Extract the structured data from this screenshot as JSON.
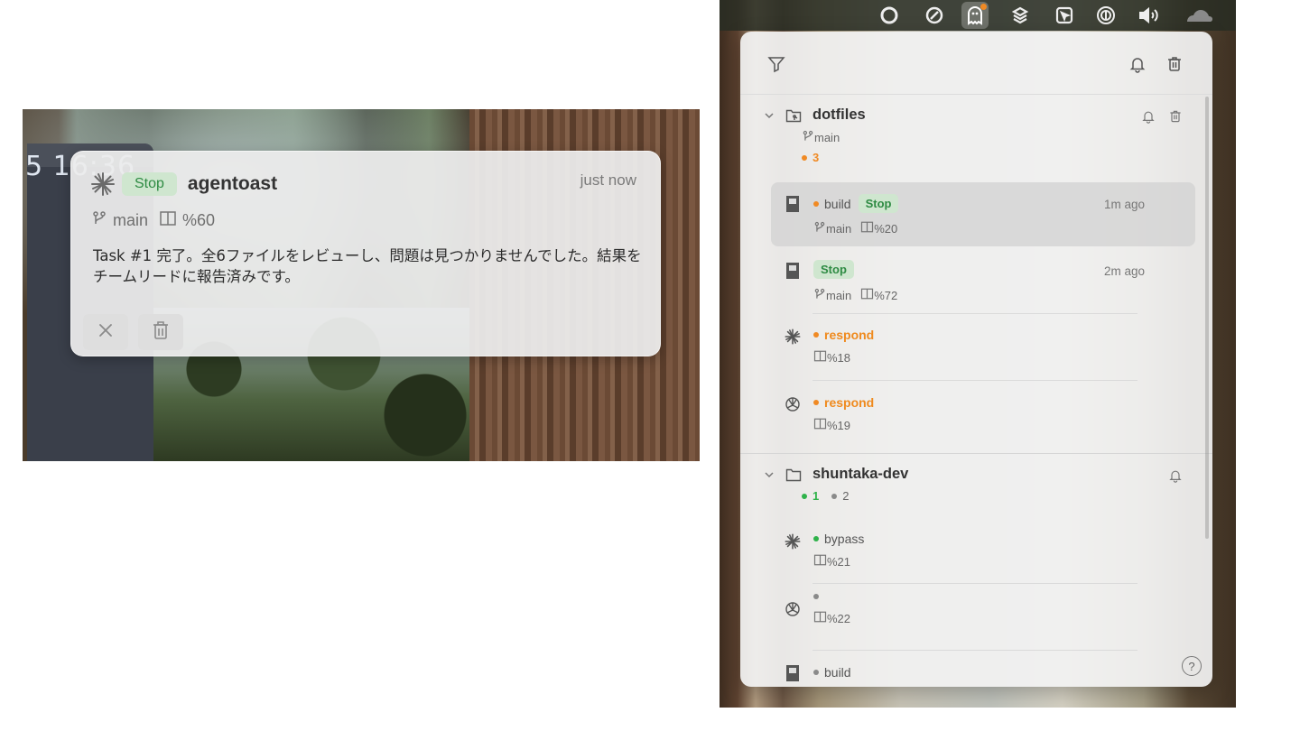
{
  "toast": {
    "clock_text": "5 16:36",
    "badge": "Stop",
    "title": "agentoast",
    "time": "just now",
    "branch": "main",
    "context": "%60",
    "message": "Task #1 完了。全6ファイルをレビューし、問題は見つかりませんでした。結果をチームリードに報告済みです。",
    "icons": [
      "claude-icon",
      "branch-icon",
      "context-window-icon",
      "close-icon",
      "trash-icon"
    ]
  },
  "menubar": {
    "icons": [
      "circle-app-icon",
      "moon-icon",
      "agentoast-ghost-icon",
      "layers-icon",
      "cursor-icon",
      "password-icon",
      "volume-icon",
      "cloudflare-icon"
    ],
    "notification_color": "#f08a24"
  },
  "popover": {
    "toolbar": {
      "icons": [
        "filter-icon",
        "bell-icon",
        "trash-icon"
      ]
    },
    "groups": [
      {
        "name": "dotfiles",
        "branch": "main",
        "count": "3",
        "count_color": "#f08a24",
        "sessions": [
          {
            "agent": "opencode",
            "status_dot": "orange",
            "label": "build",
            "badge": "Stop",
            "time": "1m ago",
            "branch": "main",
            "context": "%20",
            "active": true
          },
          {
            "agent": "opencode",
            "status_dot": "",
            "label": "",
            "badge": "Stop",
            "time": "2m ago",
            "branch": "main",
            "context": "%72"
          },
          {
            "agent": "claude",
            "status_dot": "orange",
            "label": "respond",
            "context": "%18"
          },
          {
            "agent": "openai",
            "status_dot": "orange",
            "label": "respond",
            "context": "%19"
          }
        ]
      },
      {
        "name": "shuntaka-dev",
        "count_green": "1",
        "count_gray": "2",
        "sessions": [
          {
            "agent": "claude",
            "status_dot": "green",
            "label": "bypass",
            "context": "%21"
          },
          {
            "agent": "openai",
            "status_dot": "gray",
            "label": "",
            "context": "%22"
          },
          {
            "agent": "opencode",
            "status_dot": "gray",
            "label": "build"
          }
        ]
      }
    ],
    "help": "?"
  }
}
